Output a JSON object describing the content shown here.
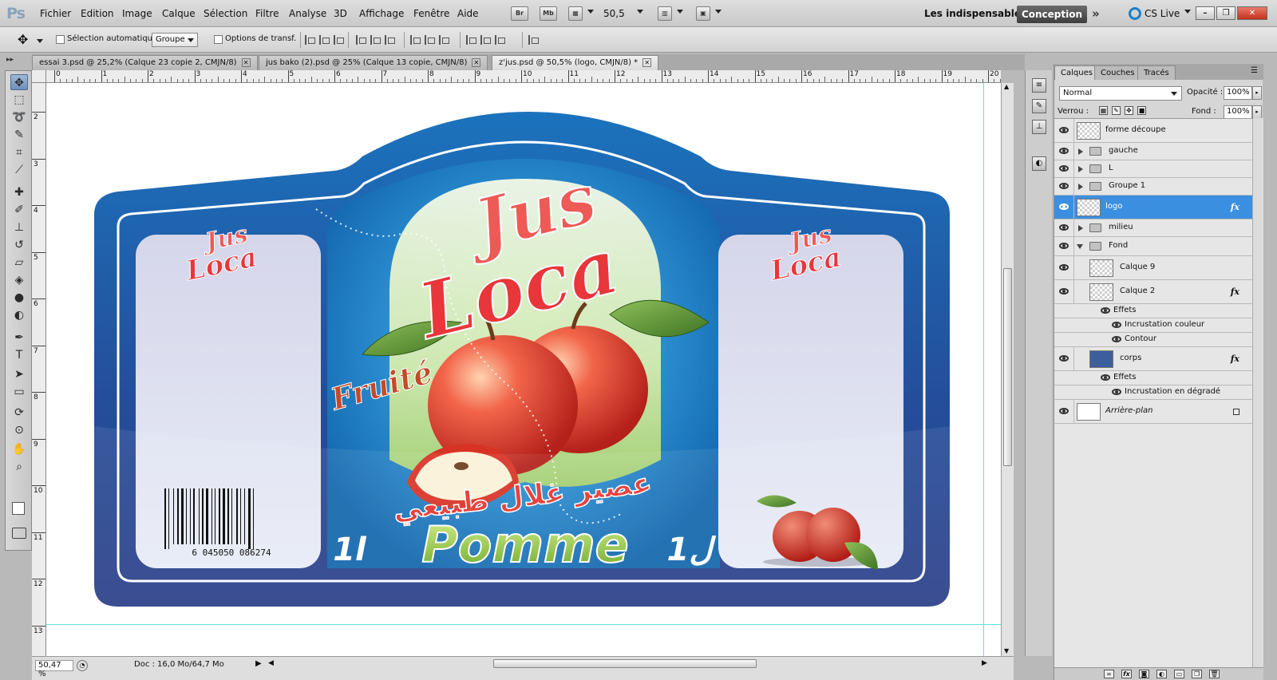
{
  "app": {
    "logo": "Ps"
  },
  "menu": [
    "Fichier",
    "Edition",
    "Image",
    "Calque",
    "Sélection",
    "Filtre",
    "Analyse",
    "3D",
    "Affichage",
    "Fenêtre",
    "Aide"
  ],
  "appbar": {
    "bridge": "Br",
    "minibridge": "Mb",
    "zoom": "50,5",
    "workspace_label": "Les indispensables",
    "workspace_active": "Conception",
    "more": "»",
    "cslive": "CS Live"
  },
  "window_buttons": {
    "minimize": "–",
    "restore": "❐",
    "close": "✕"
  },
  "options": {
    "auto_select_label": "Sélection automatique :",
    "auto_select_value": "Groupe",
    "transform_label": "Options de transf."
  },
  "tabs": [
    {
      "label": "essai 3.psd @ 25,2% (Calque 23 copie 2, CMJN/8)",
      "active": false
    },
    {
      "label": "jus bako (2).psd @ 25% (Calque 13 copie, CMJN/8)",
      "active": false
    },
    {
      "label": "z'jus.psd @ 50,5% (logo, CMJN/8) *",
      "active": true
    }
  ],
  "tools": [
    {
      "icon": "move-icon",
      "glyph": "✥"
    },
    {
      "icon": "marquee-icon",
      "glyph": "⬚"
    },
    {
      "icon": "lasso-icon",
      "glyph": "➰"
    },
    {
      "icon": "quick-select-icon",
      "glyph": "✎"
    },
    {
      "icon": "crop-icon",
      "glyph": "⌗"
    },
    {
      "icon": "eyedropper-icon",
      "glyph": "⟋"
    },
    {
      "icon": "healing-icon",
      "glyph": "✚"
    },
    {
      "icon": "brush-icon",
      "glyph": "✐"
    },
    {
      "icon": "stamp-icon",
      "glyph": "⊥"
    },
    {
      "icon": "history-brush-icon",
      "glyph": "↺"
    },
    {
      "icon": "eraser-icon",
      "glyph": "▱"
    },
    {
      "icon": "bucket-icon",
      "glyph": "◈"
    },
    {
      "icon": "blur-icon",
      "glyph": "●"
    },
    {
      "icon": "dodge-icon",
      "glyph": "◐"
    },
    {
      "icon": "pen-icon",
      "glyph": "✒"
    },
    {
      "icon": "type-icon",
      "glyph": "T"
    },
    {
      "icon": "path-select-icon",
      "glyph": "➤"
    },
    {
      "icon": "shape-icon",
      "glyph": "▭"
    },
    {
      "icon": "3d-rotate-icon",
      "glyph": "⟳"
    },
    {
      "icon": "3d-orbit-icon",
      "glyph": "⊙"
    },
    {
      "icon": "hand-icon",
      "glyph": "✋"
    },
    {
      "icon": "zoom-icon",
      "glyph": "⌕"
    }
  ],
  "ruler_top": [
    "0",
    "1",
    "2",
    "3",
    "4",
    "5",
    "6",
    "7",
    "8",
    "9",
    "10",
    "11",
    "12",
    "13",
    "14",
    "15",
    "16",
    "17",
    "18",
    "19",
    "20"
  ],
  "ruler_left": [
    "2",
    "3",
    "4",
    "5",
    "6",
    "7",
    "8",
    "9",
    "10",
    "11",
    "12",
    "13"
  ],
  "canvas": {
    "big_logo_line1": "Jus",
    "big_logo_line2": "Loca",
    "small_logo_line1": "Jus",
    "small_logo_line2": "Loca",
    "fruity": "Fruité",
    "arabic_text": "عصير غلال طبيعي",
    "product_name": "Pomme",
    "volume_left": "1l",
    "volume_right": "1ل",
    "barcode_digits": "6  045050  086274",
    "colors": {
      "frame_dark": "#2a3d86",
      "panel_blue": "#1a78c2",
      "sky": "#5fb3e8",
      "title_red": "#e8363b",
      "apple_red": "#d83224",
      "leaf_green": "#4e8a2e",
      "pomme_green": "#8cc63f"
    }
  },
  "status": {
    "zoom": "50,47 %",
    "doc": "Doc : 16,0 Mo/64,7 Mo"
  },
  "layers_panel": {
    "tabs": [
      {
        "label": "Calques",
        "active": true
      },
      {
        "label": "Couches",
        "active": false
      },
      {
        "label": "Tracés",
        "active": false
      }
    ],
    "blend_mode": "Normal",
    "opacity_label": "Opacité :",
    "opacity": "100%",
    "lock_label": "Verrou :",
    "fill_label": "Fond :",
    "fill": "100%",
    "rows": [
      {
        "name": "forme découpe",
        "kind": "layer",
        "indent": 0,
        "thumb": "checker",
        "fx": false,
        "selected": false
      },
      {
        "name": "gauche",
        "kind": "group",
        "indent": 0,
        "expanded": false
      },
      {
        "name": "L",
        "kind": "group",
        "indent": 0,
        "expanded": false
      },
      {
        "name": "Groupe 1",
        "kind": "group",
        "indent": 0,
        "expanded": false
      },
      {
        "name": "logo",
        "kind": "layer",
        "indent": 0,
        "thumb": "checker",
        "fx": true,
        "selected": true
      },
      {
        "name": "milieu",
        "kind": "group",
        "indent": 0,
        "expanded": false
      },
      {
        "name": "Fond",
        "kind": "group",
        "indent": 0,
        "expanded": true
      },
      {
        "name": "Calque 9",
        "kind": "layer",
        "indent": 1,
        "thumb": "checker",
        "fx": false,
        "selected": false
      },
      {
        "name": "Calque 2",
        "kind": "layer",
        "indent": 1,
        "thumb": "checker",
        "fx": true,
        "selected": false
      },
      {
        "name": "Effets",
        "kind": "effects",
        "indent": 1
      },
      {
        "name": "Incrustation couleur",
        "kind": "effect",
        "indent": 2
      },
      {
        "name": "Contour",
        "kind": "effect",
        "indent": 2
      },
      {
        "name": "corps",
        "kind": "layer",
        "indent": 1,
        "thumb": "blue",
        "fx": true,
        "selected": false
      },
      {
        "name": "Effets",
        "kind": "effects",
        "indent": 1
      },
      {
        "name": "Incrustation en dégradé",
        "kind": "effect",
        "indent": 2
      },
      {
        "name": "Arrière-plan",
        "kind": "background",
        "indent": 0,
        "thumb": "white",
        "locked": true
      }
    ],
    "bottom_fx": "fx"
  }
}
